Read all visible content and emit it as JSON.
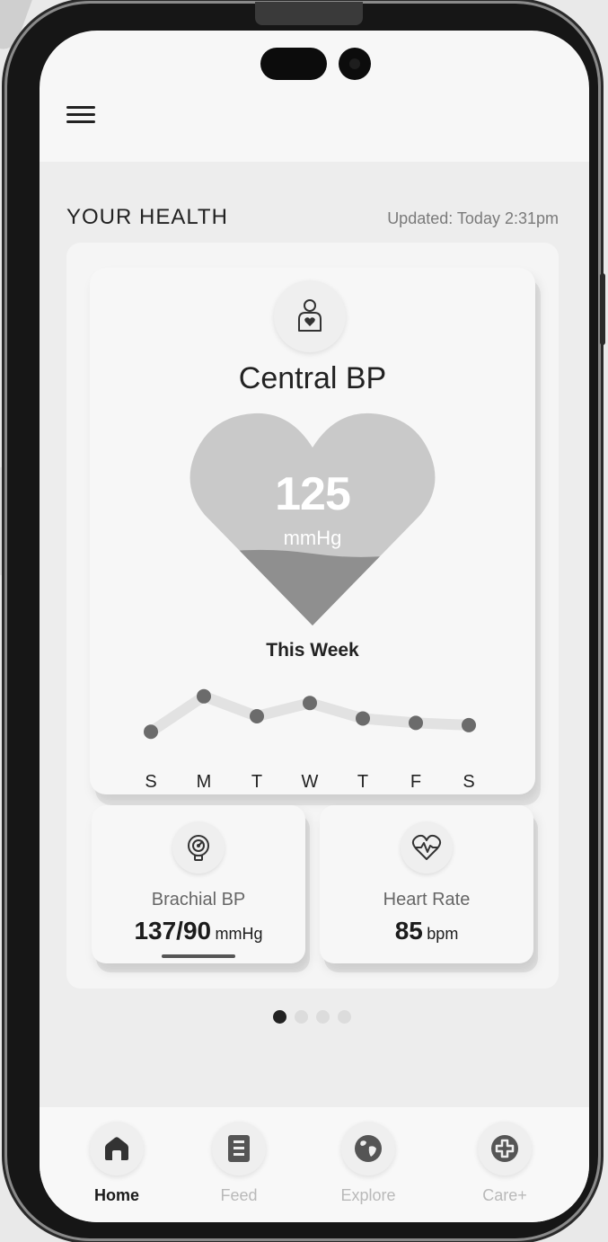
{
  "header": {
    "menu_icon": "hamburger-menu-icon"
  },
  "health": {
    "section_title": "YOUR HEALTH",
    "updated": "Updated: Today 2:31pm"
  },
  "central_bp": {
    "icon": "person-heart-icon",
    "title": "Central BP",
    "value": "125",
    "unit": "mmHg",
    "fill_level_fraction": 0.35
  },
  "chart_data": {
    "type": "line",
    "title": "This Week",
    "categories": [
      "S",
      "M",
      "T",
      "W",
      "T",
      "F",
      "S"
    ],
    "series": [
      {
        "values": [
          118,
          134,
          125,
          131,
          124,
          122,
          121
        ]
      }
    ],
    "ylim": [
      110,
      140
    ],
    "grid": false
  },
  "cards": {
    "brachial": {
      "icon": "gauge-icon",
      "label": "Brachial BP",
      "value": "137/90",
      "unit": "mmHg"
    },
    "heart_rate": {
      "icon": "heart-pulse-icon",
      "label": "Heart Rate",
      "value": "85",
      "unit": "bpm"
    }
  },
  "pager": {
    "count": 4,
    "active_index": 0
  },
  "nav": {
    "items": [
      {
        "label": "Home",
        "icon": "home-icon",
        "active": true
      },
      {
        "label": "Feed",
        "icon": "document-icon",
        "active": false
      },
      {
        "label": "Explore",
        "icon": "globe-icon",
        "active": false
      },
      {
        "label": "Care+",
        "icon": "plus-circle-icon",
        "active": false
      }
    ]
  },
  "colors": {
    "heart_top": "#c9c9c9",
    "heart_fill": "#8f8f8f",
    "chart_dot": "#6b6b6b",
    "chart_line": "#e2e2e2",
    "accent_dark": "#222222",
    "nav_inactive": "#b9b9b9"
  }
}
